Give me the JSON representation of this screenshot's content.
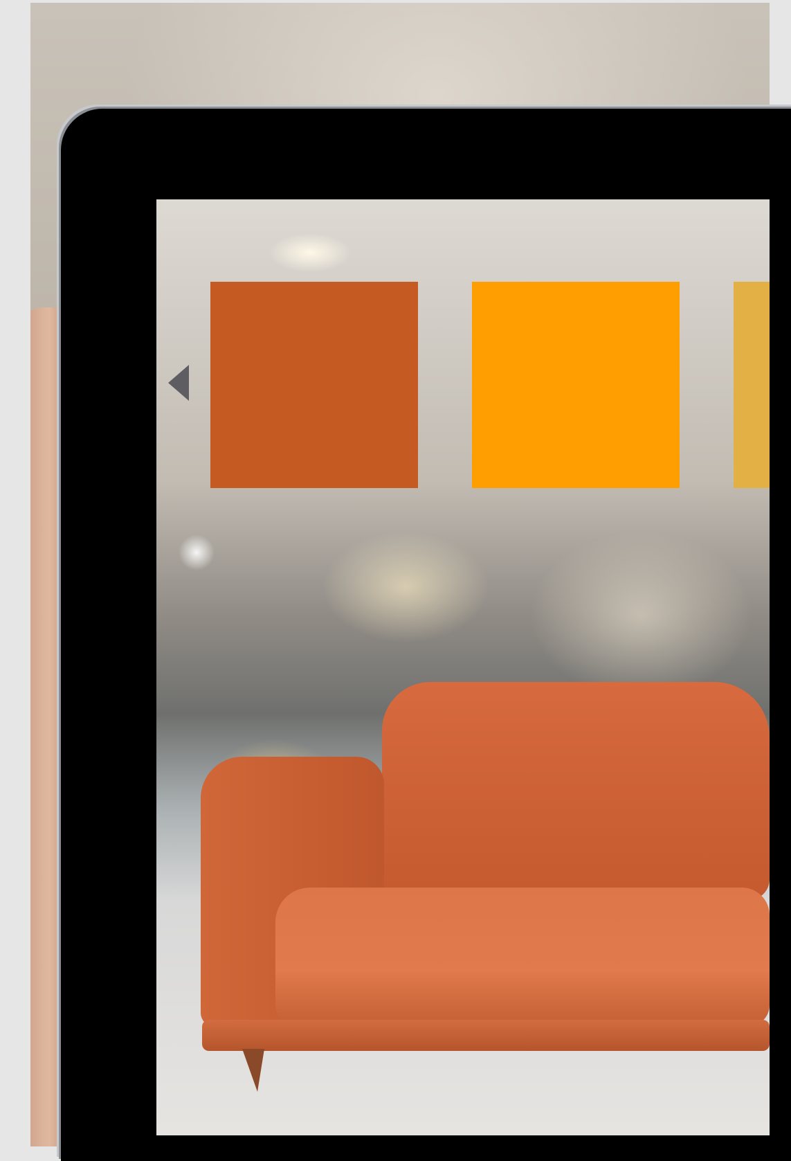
{
  "scene": {
    "background_description_icon": "blurred-mall-photo",
    "device_icon": "tablet"
  },
  "color_picker": {
    "prev_icon": "triangle-left-icon",
    "swatches": [
      {
        "name": "burnt-orange",
        "color": "#C55A22"
      },
      {
        "name": "orange",
        "color": "#FF9E00"
      },
      {
        "name": "mustard",
        "color": "#E3B046"
      }
    ]
  },
  "product": {
    "icon": "sofa-icon",
    "color": "#D96B3E"
  }
}
